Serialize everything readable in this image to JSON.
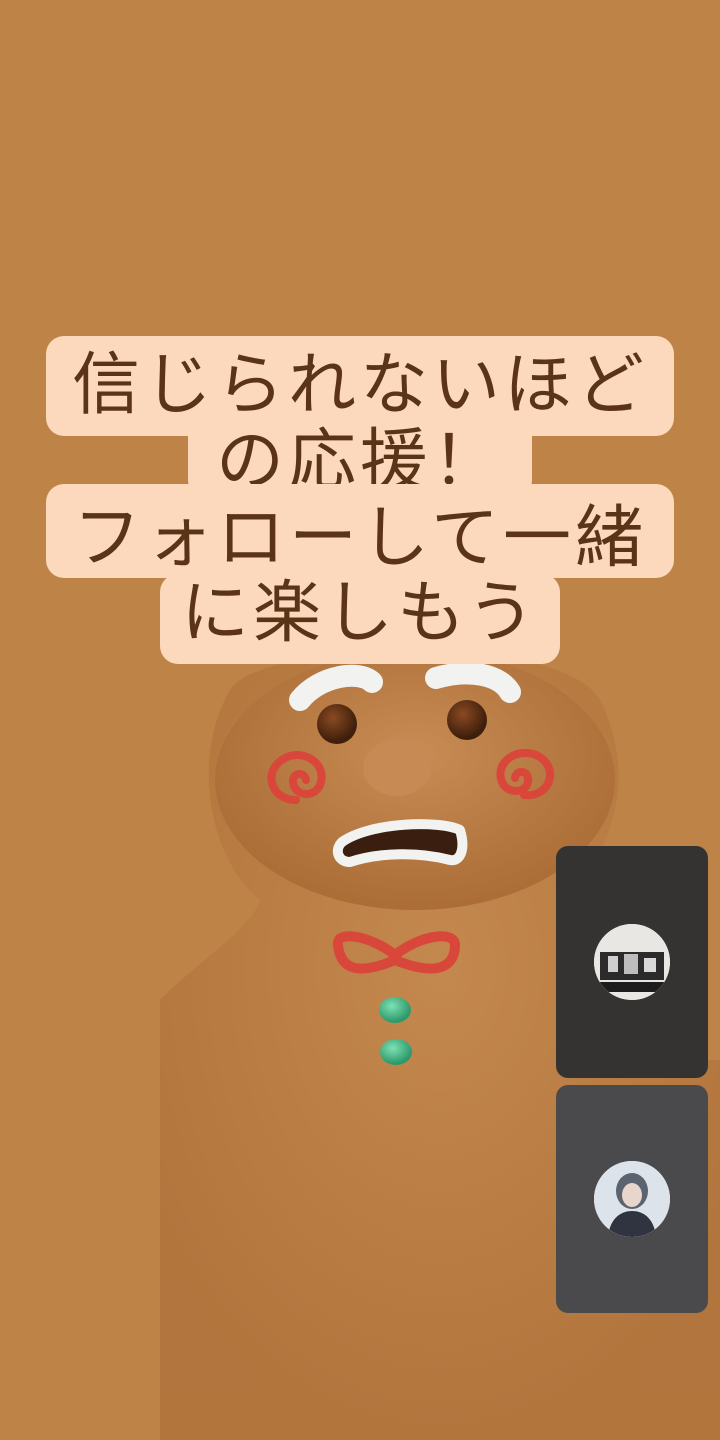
{
  "caption": {
    "line1": "信じられないほど",
    "line2": "の応援！",
    "line3": "フォローして一緒",
    "line4": "に楽しもう"
  },
  "colors": {
    "background": "#bd8347",
    "caption_bg": "#fcd9bd",
    "caption_text": "#5b3418",
    "tile1_bg": "#343332",
    "tile2_bg": "#4a4a4c"
  },
  "participants": [
    {
      "avatar": "participant-avatar-photo"
    },
    {
      "avatar": "participant-avatar-photo"
    }
  ]
}
